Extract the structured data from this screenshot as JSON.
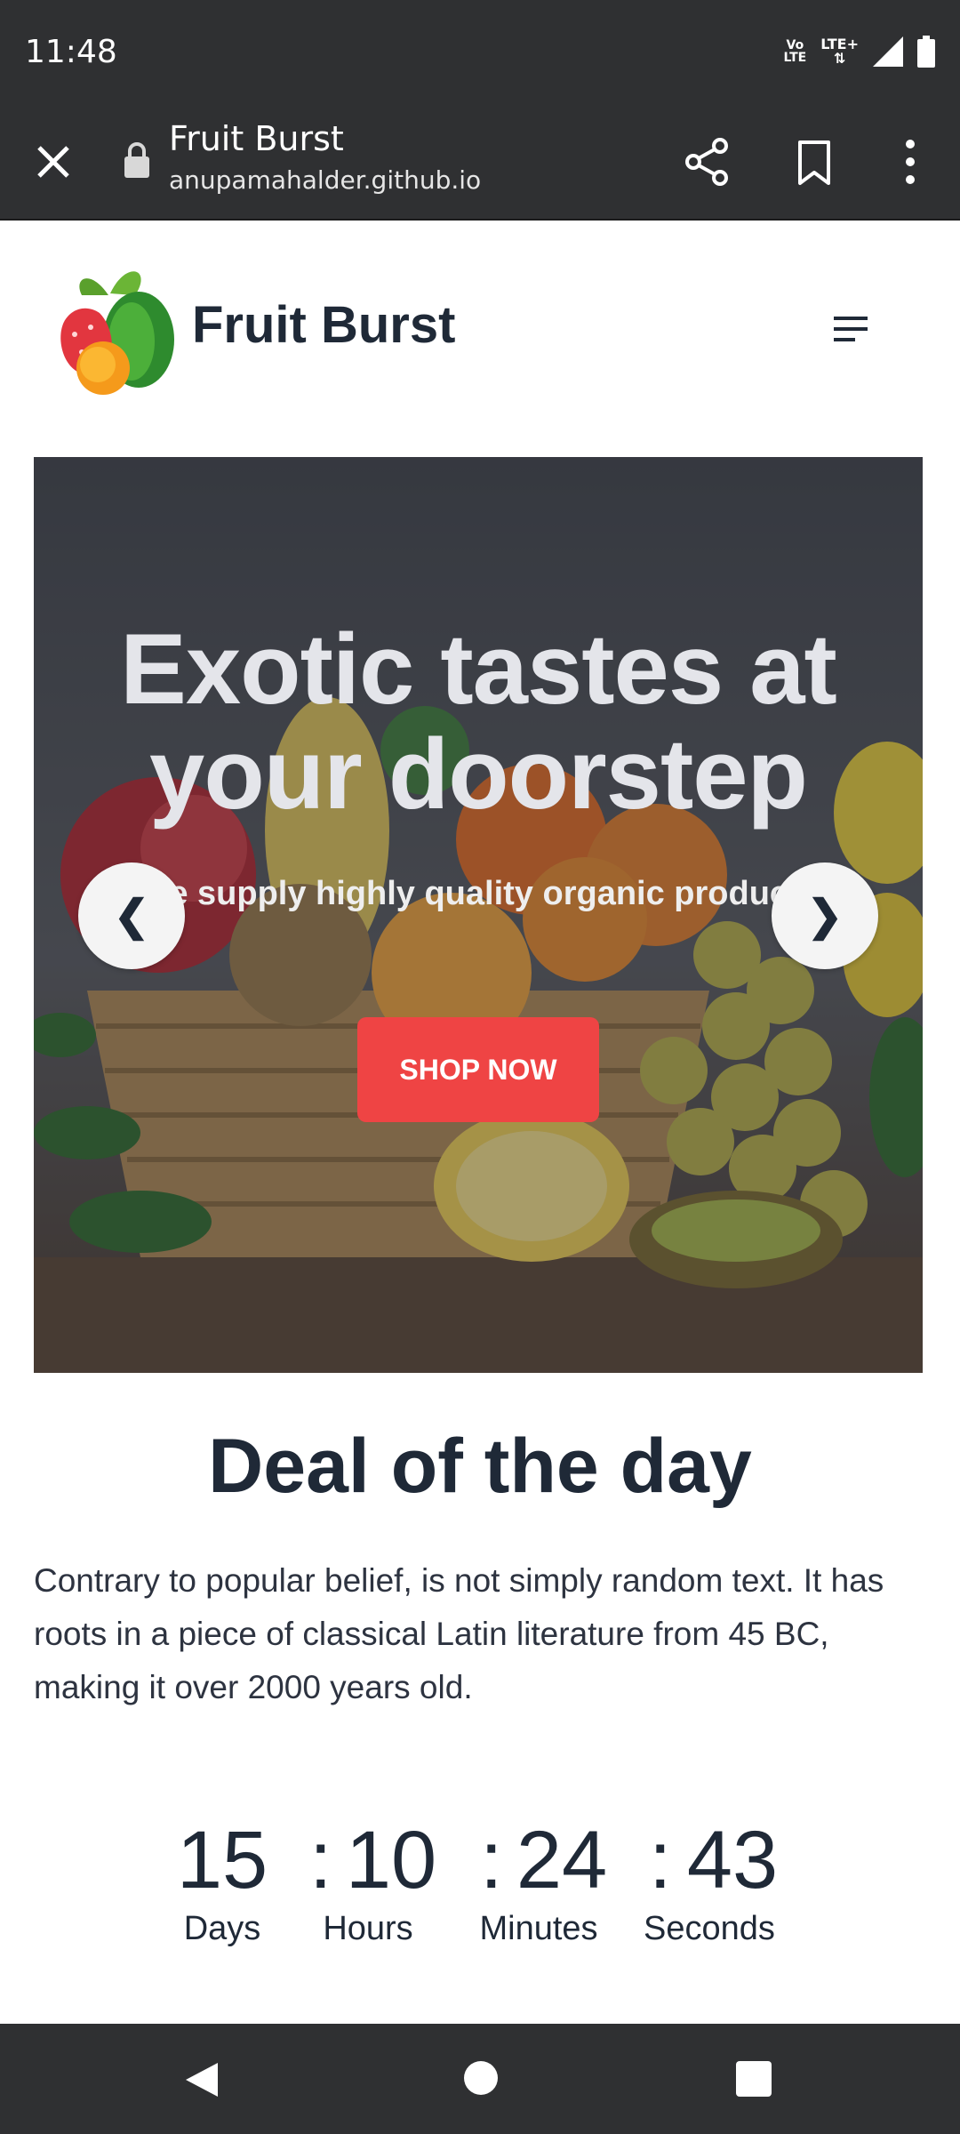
{
  "status_bar": {
    "time": "11:48",
    "volte_line1": "Vo",
    "volte_line2": "LTE",
    "lte_label": "LTE+"
  },
  "browser": {
    "page_title": "Fruit Burst",
    "url": "anupamahalder.github.io"
  },
  "site": {
    "brand": "Fruit Burst"
  },
  "hero": {
    "title_line1": "Exotic tastes at",
    "title_line2": "your doorstep",
    "subtitle": "We supply highly quality organic products",
    "cta_label": "SHOP NOW",
    "prev_label": "❮",
    "next_label": "❯"
  },
  "deal": {
    "title": "Deal of the day",
    "body": "Contrary to popular belief, is not simply random text. It has roots in a piece of classical Latin literature from 45 BC, making it over 2000 years old.",
    "countdown": [
      {
        "value": "15",
        "label": "Days"
      },
      {
        "value": "10",
        "label": "Hours"
      },
      {
        "value": "24",
        "label": "Minutes"
      },
      {
        "value": "43",
        "label": "Seconds"
      }
    ],
    "separator": ":"
  },
  "colors": {
    "accent": "#ef4444",
    "text_dark": "#1f2937",
    "chrome": "#2f3032"
  }
}
